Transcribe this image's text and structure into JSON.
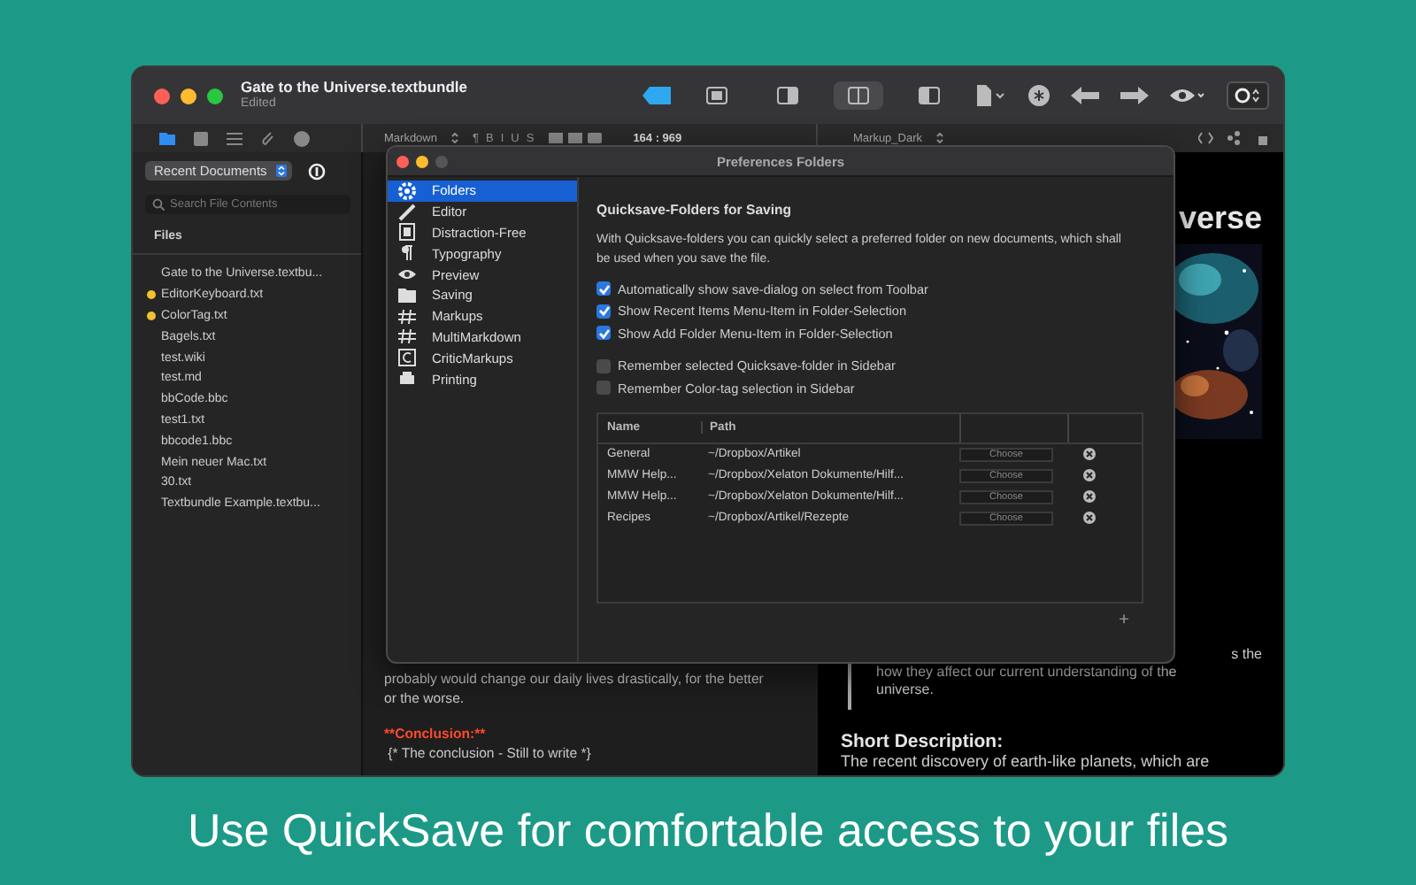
{
  "window": {
    "title": "Gate to the Universe.textbundle",
    "subtitle": "Edited"
  },
  "toolbar": {
    "layout_modes": [
      {
        "selected": false
      },
      {
        "selected": false
      },
      {
        "selected": true
      },
      {
        "selected": false
      }
    ]
  },
  "sidebar": {
    "tabs": [
      {
        "selected": true
      },
      {
        "selected": false
      },
      {
        "selected": false
      },
      {
        "selected": false
      },
      {
        "selected": false
      }
    ],
    "source": "Recent Documents",
    "search": {
      "placeholder": "Search File Contents"
    },
    "section": "Files",
    "files": [
      {
        "name": "Gate to the Universe.textbu..."
      },
      {
        "name": "EditorKeyboard.txt",
        "color": "#f2c12e"
      },
      {
        "name": "ColorTag.txt",
        "color": "#f2c12e"
      },
      {
        "name": "Bagels.txt"
      },
      {
        "name": "test.wiki"
      },
      {
        "name": "test.md"
      },
      {
        "name": "bbCode.bbc"
      },
      {
        "name": "test1.txt"
      },
      {
        "name": "bbcode1.bbc"
      },
      {
        "name": "Mein neuer Mac.txt"
      },
      {
        "name": "30.txt"
      },
      {
        "name": "Textbundle Example.textbu..."
      }
    ]
  },
  "editor_bar": {
    "syntax": "Markdown",
    "format_marks": [
      "¶",
      "B",
      "I",
      "U",
      "S"
    ],
    "position": "164 : 969",
    "theme": "Markup_Dark"
  },
  "editor": {
    "lines": [
      {
        "kind": "text",
        "text": "probably would change our daily lives drastically, for the better"
      },
      {
        "kind": "text",
        "text": "or the worse."
      },
      {
        "kind": "blank"
      },
      {
        "kind": "heading",
        "text": "**Conclusion:**"
      },
      {
        "kind": "text",
        "text": " {* The conclusion - Still to write *}"
      }
    ]
  },
  "preview": {
    "title": "verse",
    "quote": [
      "s the",
      "how they affect our current understanding of the",
      "universe."
    ],
    "heading": "Short Description:",
    "paragraph": "The recent discovery of earth-like planets, which are"
  },
  "preferences": {
    "title": "Preferences Folders",
    "categories": [
      {
        "label": "Folders",
        "selected": true
      },
      {
        "label": "Editor",
        "selected": false
      },
      {
        "label": "Distraction-Free",
        "selected": false
      },
      {
        "label": "Typography",
        "selected": false
      },
      {
        "label": "Preview",
        "selected": false
      },
      {
        "label": "Saving",
        "selected": false
      },
      {
        "label": "Markups",
        "selected": false
      },
      {
        "label": "MultiMarkdown",
        "selected": false
      },
      {
        "label": "CriticMarkups",
        "selected": false
      },
      {
        "label": "Printing",
        "selected": false
      }
    ],
    "heading": "Quicksave-Folders for Saving",
    "description": "With Quicksave-folders you can quickly select a preferred folder on new documents, which shall be used when you save the file.",
    "options": [
      {
        "label": "Automatically show save-dialog on select from Toolbar",
        "checked": true
      },
      {
        "label": "Show Recent Items Menu-Item in Folder-Selection",
        "checked": true
      },
      {
        "label": "Show Add Folder Menu-Item in Folder-Selection",
        "checked": true
      }
    ],
    "options_sidebar": [
      {
        "label": "Remember selected Quicksave-folder in Sidebar",
        "checked": false
      },
      {
        "label": "Remember Color-tag selection in Sidebar",
        "checked": false
      }
    ],
    "table": {
      "columns": [
        "Name",
        "Path"
      ],
      "rows": [
        {
          "name": "General",
          "path": "~/Dropbox/Artikel",
          "button": "Choose"
        },
        {
          "name": "MMW Help...",
          "path": "~/Dropbox/Xelaton Dokumente/Hilf...",
          "button": "Choose"
        },
        {
          "name": "MMW Help...",
          "path": "~/Dropbox/Xelaton Dokumente/Hilf...",
          "button": "Choose"
        },
        {
          "name": "Recipes",
          "path": "~/Dropbox/Artikel/Rezepte",
          "button": "Choose"
        }
      ]
    },
    "add_button": "+"
  },
  "caption": "Use QuickSave for comfortable access to your files"
}
